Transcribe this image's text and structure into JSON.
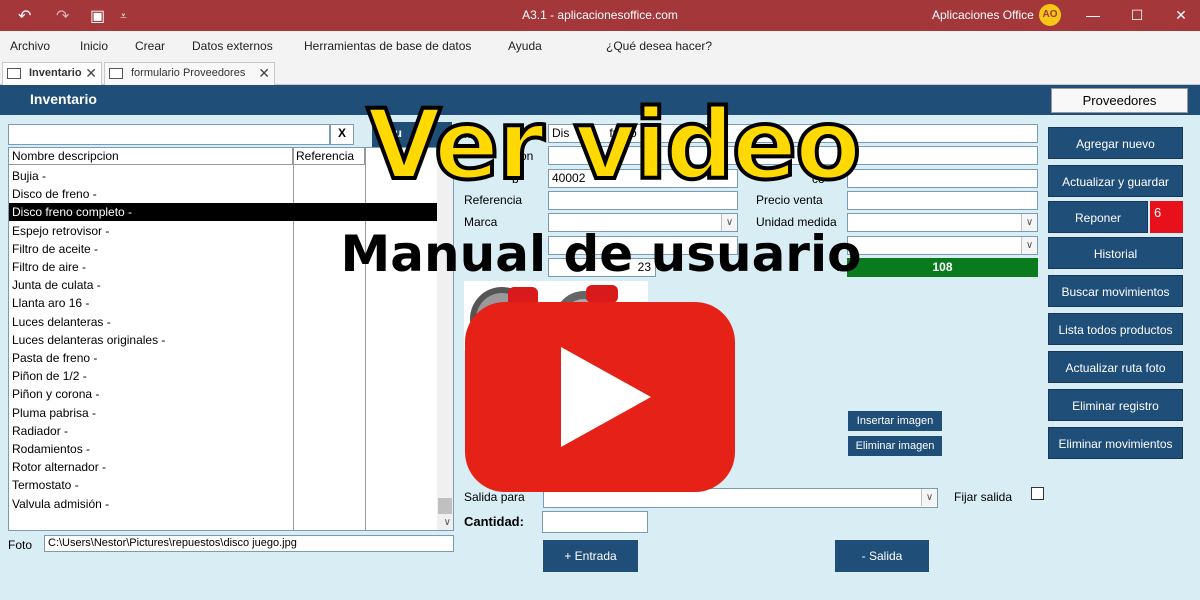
{
  "titlebar": {
    "title": "A3.1 - aplicacionesoffice.com",
    "brand": "Aplicaciones Office",
    "undo_icon": "↶",
    "redo_icon": "↷",
    "save_icon": "▣",
    "customize_icon": "⩡",
    "minimize": "—",
    "maximize": "☐",
    "close": "✕"
  },
  "menu": {
    "items": [
      "Archivo",
      "Inicio",
      "Crear",
      "Datos externos",
      "Herramientas de base de datos",
      "Ayuda"
    ],
    "search_placeholder": "¿Qué desea hacer?"
  },
  "tabs": [
    {
      "label": "Inventario",
      "close": "✕"
    },
    {
      "label": "formulario Proveedores",
      "close": "✕"
    }
  ],
  "form": {
    "title": "Inventario",
    "proveedores_button": "Proveedores",
    "search_clear": "X",
    "search_button_partial": "Bu",
    "list": {
      "headers": [
        "Nombre descripcion",
        "Referencia"
      ],
      "rows": [
        "Bujia -",
        "Disco de freno -",
        "Disco freno completo -",
        "Espejo retrovisor -",
        "Filtro de aceite -",
        "Filtro de aire -",
        "Junta de culata -",
        "Llanta aro 16 -",
        "Luces delanteras -",
        "Luces delanteras originales -",
        "Pasta de freno -",
        "Piñon de 1/2 -",
        "Piñon y corona -",
        "Pluma pabrisa -",
        "Radiador  -",
        "Rodamientos -",
        "Rotor alternador -",
        "Termostato  -",
        "Valvula admisión -"
      ],
      "selected_index": 2
    },
    "foto": {
      "label": "Foto",
      "value": "C:\\Users\\Nestor\\Pictures\\repuestos\\disco juego.jpg"
    },
    "fields": {
      "nombre_label_partial": "mbre",
      "nombre_value_partial": "Dis",
      "nombre_value_partial2": "freno",
      "descripcion_label_partial": "on",
      "codigo_label_partial": "b",
      "codigo_value_partial": "40002",
      "precio_compra_label_partial": "co",
      "referencia_label": "Referencia",
      "precio_venta_label": "Precio venta",
      "marca_label": "Marca",
      "unidad_medida_label": "Unidad medida",
      "stock_value_partial": "23",
      "stock_label_partial": "t",
      "stock_total": "108",
      "reponer_count": "6"
    },
    "image_buttons": {
      "insert": "Insertar imagen",
      "delete": "Eliminar imagen"
    },
    "salida": {
      "label": "Salida para",
      "fijar_label": "Fijar salida",
      "cantidad_label": "Cantidad:"
    },
    "actions": {
      "entrada": "+ Entrada",
      "salida": "- Salida"
    },
    "right_buttons": [
      "Agregar nuevo",
      "Actualizar y guardar",
      "Reponer",
      "Historial",
      "Buscar movimientos",
      "Lista todos productos",
      "Actualizar ruta foto",
      "Eliminar registro",
      "Eliminar movimientos"
    ]
  },
  "overlay": {
    "title": "Ver video",
    "subtitle": "Manual de usuario"
  },
  "colors": {
    "titlebar": "#a4373a",
    "header": "#1f4e79",
    "background": "#d9eef4",
    "stock_bar": "#0a7a1f",
    "reponer_alert": "#e8101a",
    "overlay_title": "#ffd900",
    "youtube": "#e62117"
  }
}
